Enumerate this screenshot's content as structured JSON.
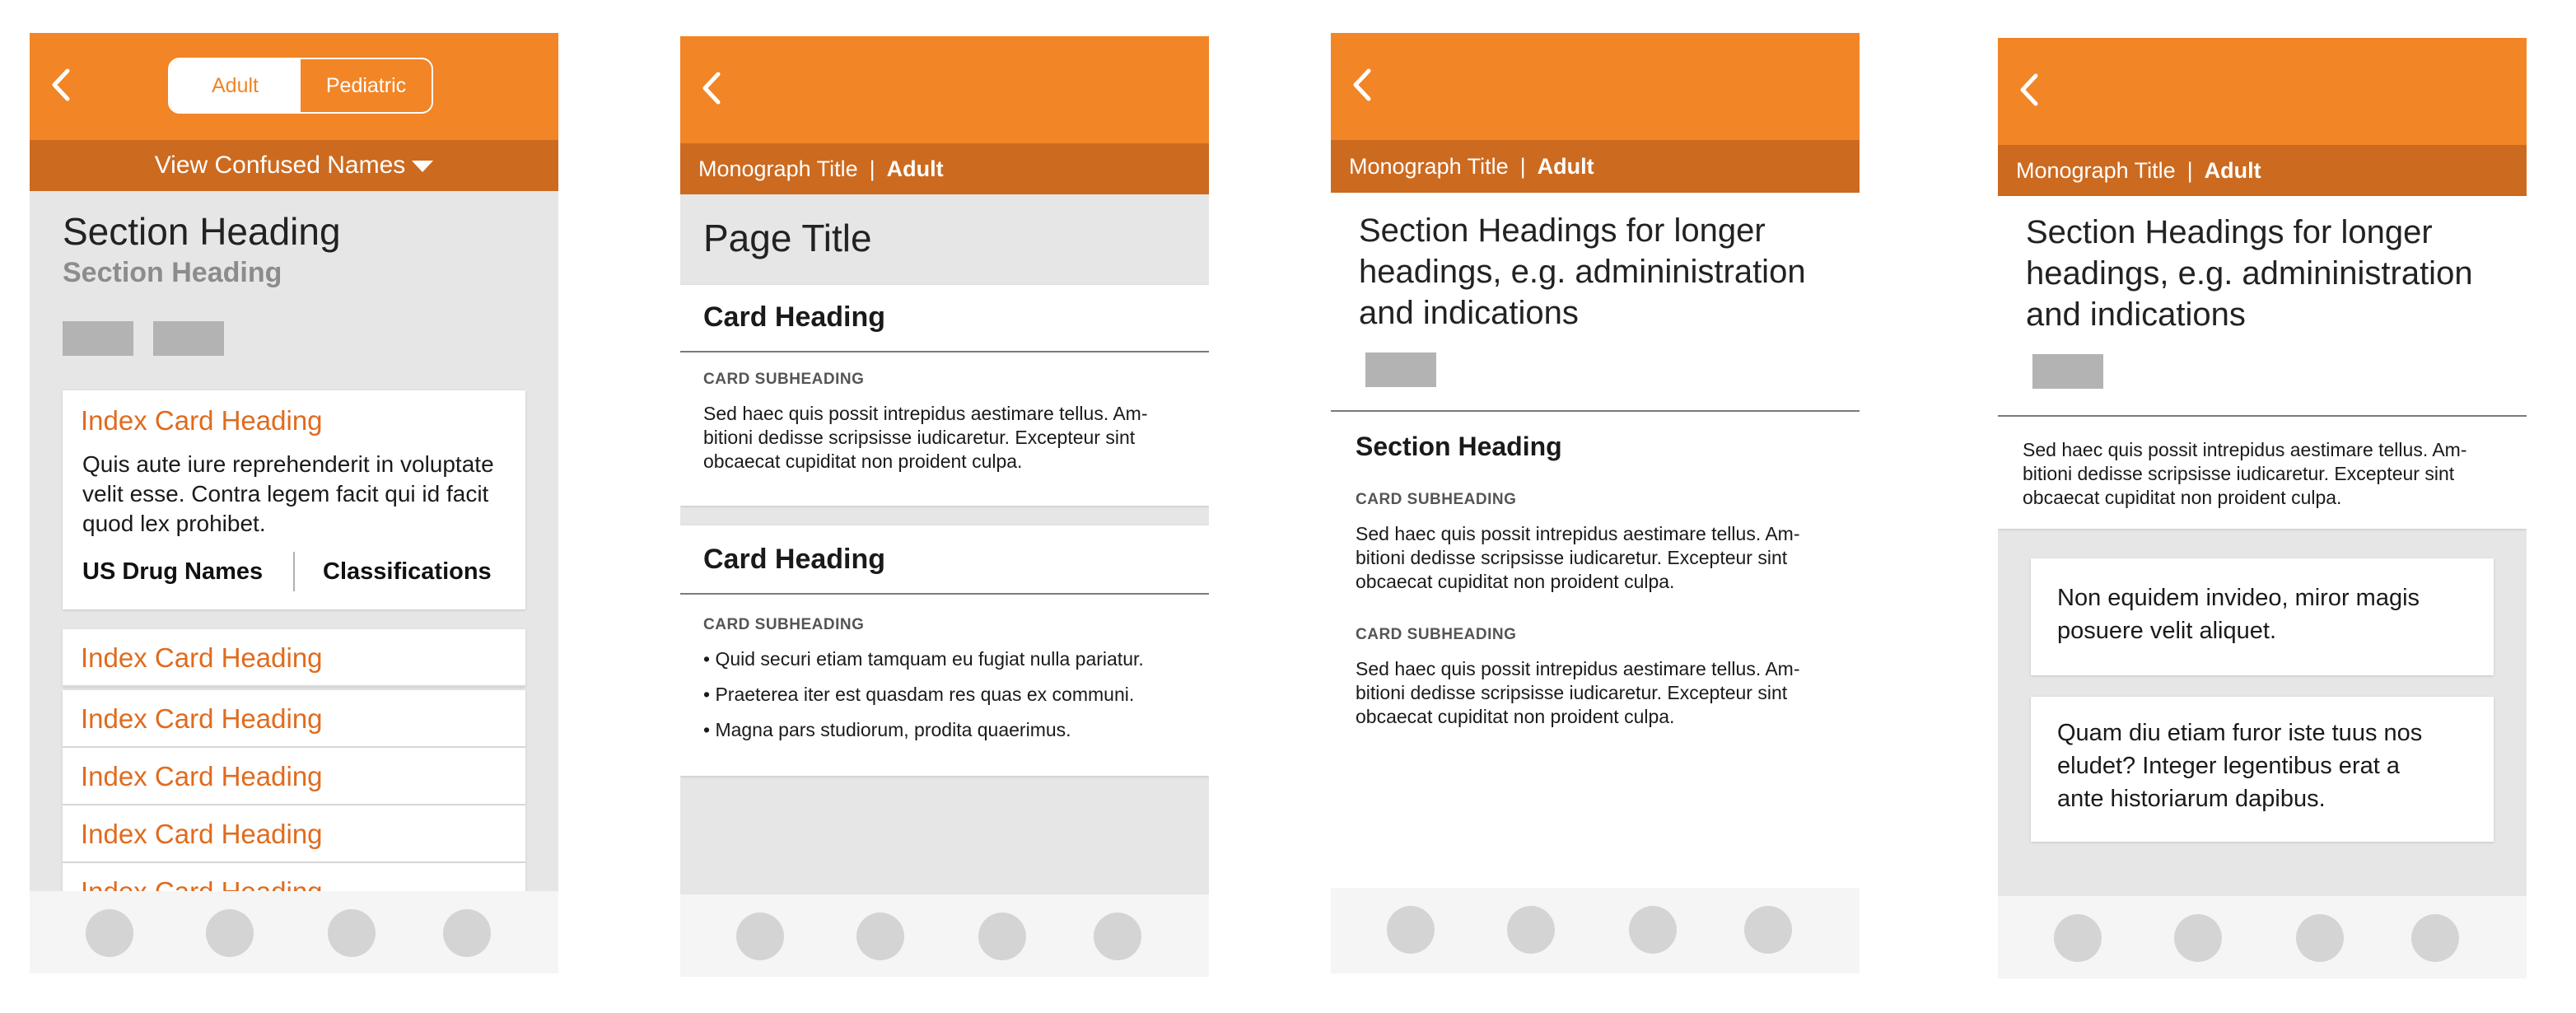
{
  "screen1": {
    "toggle": {
      "adult": "Adult",
      "pediatric": "Pediatric"
    },
    "confused_names": "View Confused Names",
    "section_heading": "Section Heading",
    "section_subheading": "Section Heading",
    "index_card": {
      "title": "Index Card Heading",
      "body": "Quis aute iure reprehenderit in voluptate velit esse. Contra legem facit qui id facit quod lex prohibet.",
      "link_left": "US Drug Names",
      "link_right": "Classifications"
    },
    "index_rows": [
      "Index Card Heading",
      "Index Card Heading",
      "Index Card Heading",
      "Index Card Heading",
      "Index Card Heading"
    ]
  },
  "screen2": {
    "monograph": "Monograph Title",
    "population": "Adult",
    "page_title": "Page Title",
    "card1": {
      "heading": "Card Heading",
      "subheading": "CARD SUBHEADING",
      "body_lines": [
        "Sed haec quis possit intrepidus aestimare tellus. Am-",
        "bitioni dedisse scripsisse iudicaretur. Excepteur sint",
        "obcaecat cupiditat non proident culpa."
      ]
    },
    "card2": {
      "heading": "Card Heading",
      "subheading": "CARD SUBHEADING",
      "bullets": [
        "• Quid securi etiam tamquam eu fugiat nulla pariatur.",
        "• Praeterea iter est quasdam res quas ex communi.",
        "• Magna pars studiorum, prodita quaerimus."
      ]
    }
  },
  "screen3": {
    "monograph": "Monograph Title",
    "population": "Adult",
    "heading_lines": [
      "Section Headings for longer",
      "headings, e.g. admininistration",
      "and indications"
    ],
    "section_heading": "Section Heading",
    "blocks": [
      {
        "subheading": "CARD SUBHEADING",
        "lines": [
          "Sed haec quis possit intrepidus aestimare tellus. Am-",
          "bitioni dedisse scripsisse iudicaretur. Excepteur sint",
          "obcaecat cupiditat non proident culpa."
        ]
      },
      {
        "subheading": "CARD SUBHEADING",
        "lines": [
          "Sed haec quis possit intrepidus aestimare tellus. Am-",
          "bitioni dedisse scripsisse iudicaretur. Excepteur sint",
          "obcaecat cupiditat non proident culpa."
        ]
      }
    ]
  },
  "screen4": {
    "monograph": "Monograph Title",
    "population": "Adult",
    "heading_lines": [
      "Section Headings for longer",
      "headings, e.g. admininistration",
      "and indications"
    ],
    "body_lines": [
      "Sed haec quis possit intrepidus aestimare tellus. Am-",
      "bitioni dedisse scripsisse iudicaretur. Excepteur sint",
      "obcaecat cupiditat non proident culpa."
    ],
    "card1_lines": [
      "Non equidem invideo, miror magis",
      "posuere velit aliquet."
    ],
    "card2_lines": [
      "Quam diu etiam furor iste tuus nos",
      "eludet? Integer legentibus erat a",
      "ante historiarum dapibus."
    ]
  },
  "colors": {
    "primary": "#f28526",
    "secondary": "#cc6a20",
    "link": "#e06b1e",
    "background": "#e6e6e6"
  },
  "icons": {
    "back": "chevron-left-icon",
    "nav": "tab-placeholder-icon"
  }
}
